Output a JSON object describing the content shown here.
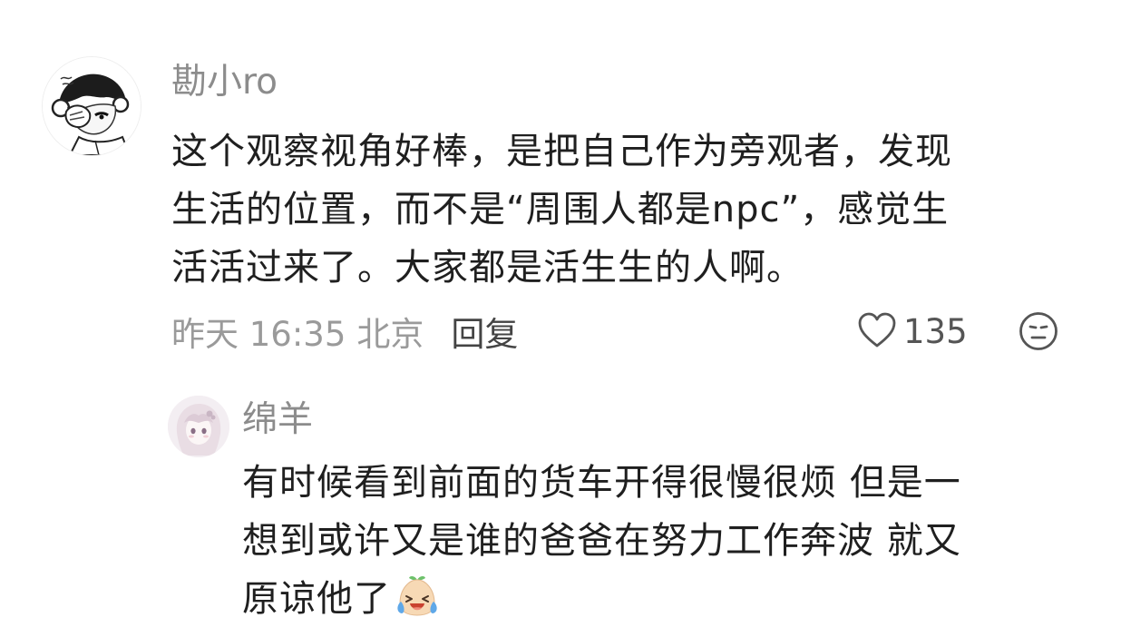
{
  "comment": {
    "username": "勘小ro",
    "lines": [
      "这个观察视角好棒，是把自己作为旁观者，发现",
      "生活的位置，而不是“周围人都是npc”，感觉生",
      "活活过来了。大家都是活生生的人啊。"
    ],
    "time": "昨天 16:35",
    "location": "北京",
    "reply_label": "回复",
    "like_count": "135",
    "icons": {
      "avatar": "sketch-avatar",
      "like": "heart-icon",
      "dislike": "neutral-face-icon"
    }
  },
  "reply": {
    "username": "绵羊",
    "lines": [
      "有时候看到前面的货车开得很慢很烦 但是一",
      "想到或许又是谁的爸爸在努力工作奔波 就又",
      "原谅他了"
    ],
    "emoji": "laughing-crying-emoji",
    "icons": {
      "avatar": "anime-avatar"
    }
  },
  "colors": {
    "username": "#8c8c8c",
    "text": "#1f1f1f",
    "meta": "#9a9a9a",
    "reply_button": "#444444",
    "emoji_face": "#f7d9b5",
    "emoji_tears": "#5fa8e8"
  }
}
